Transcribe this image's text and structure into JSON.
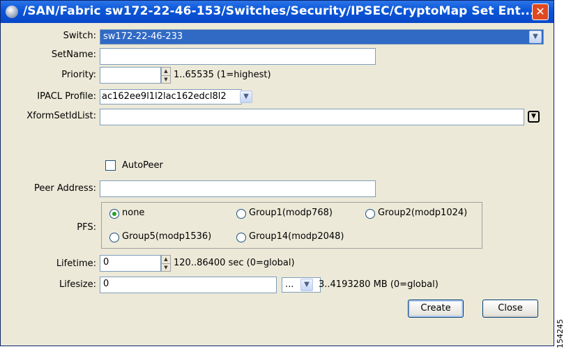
{
  "window": {
    "title": "/SAN/Fabric sw172-22-46-153/Switches/Security/IPSEC/CryptoMap Set Ent...",
    "close_glyph": "✕"
  },
  "form": {
    "switch": {
      "label": "Switch:",
      "value": "sw172-22-46-233"
    },
    "setname": {
      "label": "SetName:",
      "value": ""
    },
    "priority": {
      "label": "Priority:",
      "value": "",
      "hint": "1..65535 (1=highest)"
    },
    "ipacl": {
      "label": "IPACL Profile:",
      "value": "ac162ee9l1l2lac162edcl8l2"
    },
    "xform": {
      "label": "XformSetIdList:",
      "value": ""
    },
    "autopeer": {
      "label": "AutoPeer",
      "checked": false
    },
    "peer": {
      "label": "Peer Address:",
      "value": ""
    },
    "pfs": {
      "label": "PFS:",
      "options": [
        "none",
        "Group1(modp768)",
        "Group2(modp1024)",
        "Group5(modp1536)",
        "Group14(modp2048)"
      ],
      "selected": "none"
    },
    "lifetime": {
      "label": "Lifetime:",
      "value": "0",
      "hint": "120..86400 sec (0=global)"
    },
    "lifesize": {
      "label": "Lifesize:",
      "value": "0",
      "unit_value": "...",
      "hint": "3..4193280 MB (0=global)"
    }
  },
  "buttons": {
    "create": "Create",
    "close": "Close"
  },
  "side_text": "154245",
  "icons": {
    "spinner_up": "▲",
    "spinner_down": "▼",
    "dropdown": "▼"
  }
}
